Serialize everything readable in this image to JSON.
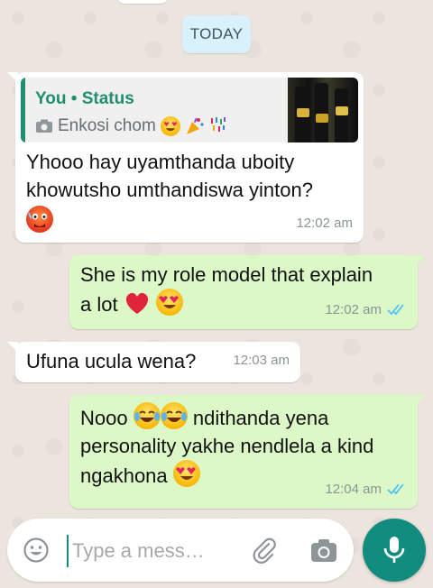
{
  "date_divider": "TODAY",
  "messages": [
    {
      "direction": "in",
      "reply_to": {
        "author": "You",
        "separator": "•",
        "kind": "Status",
        "text": "Enkosi chom",
        "emojis": [
          "heart-eyes",
          "party-popper",
          "confetti"
        ]
      },
      "lines": [
        "Yhooo hay uyamthanda uboity",
        "khowutsho umthandiswa yinton?"
      ],
      "trailing_emoji": "hot-face",
      "time": "12:02 am"
    },
    {
      "direction": "out",
      "lines": [
        "She is my role model that explain",
        "a lot"
      ],
      "trailing_emojis": [
        "red-heart",
        "heart-eyes"
      ],
      "time": "12:02 am",
      "status": "read"
    },
    {
      "direction": "in",
      "lines": [
        "Ufuna ucula wena?"
      ],
      "time": "12:03 am"
    },
    {
      "direction": "out",
      "lines": [
        "Nooo",
        "ndithanda yena",
        "personality yakhe nendlela a kind",
        "ngakhona"
      ],
      "inline_emojis": [
        "tears-of-joy",
        "tears-of-joy"
      ],
      "trailing_emoji": "heart-eyes",
      "time": "12:04 am",
      "status": "read"
    }
  ],
  "composer": {
    "placeholder": "Type a mess…",
    "icons": [
      "smiley-icon",
      "paperclip-icon",
      "camera-icon",
      "mic-icon"
    ]
  },
  "colors": {
    "outgoing_bubble": "#dcf8c6",
    "incoming_bubble": "#ffffff",
    "accent": "#128c7e",
    "read_ticks": "#4fc3f7",
    "reply_author": "#1f8f6e"
  }
}
